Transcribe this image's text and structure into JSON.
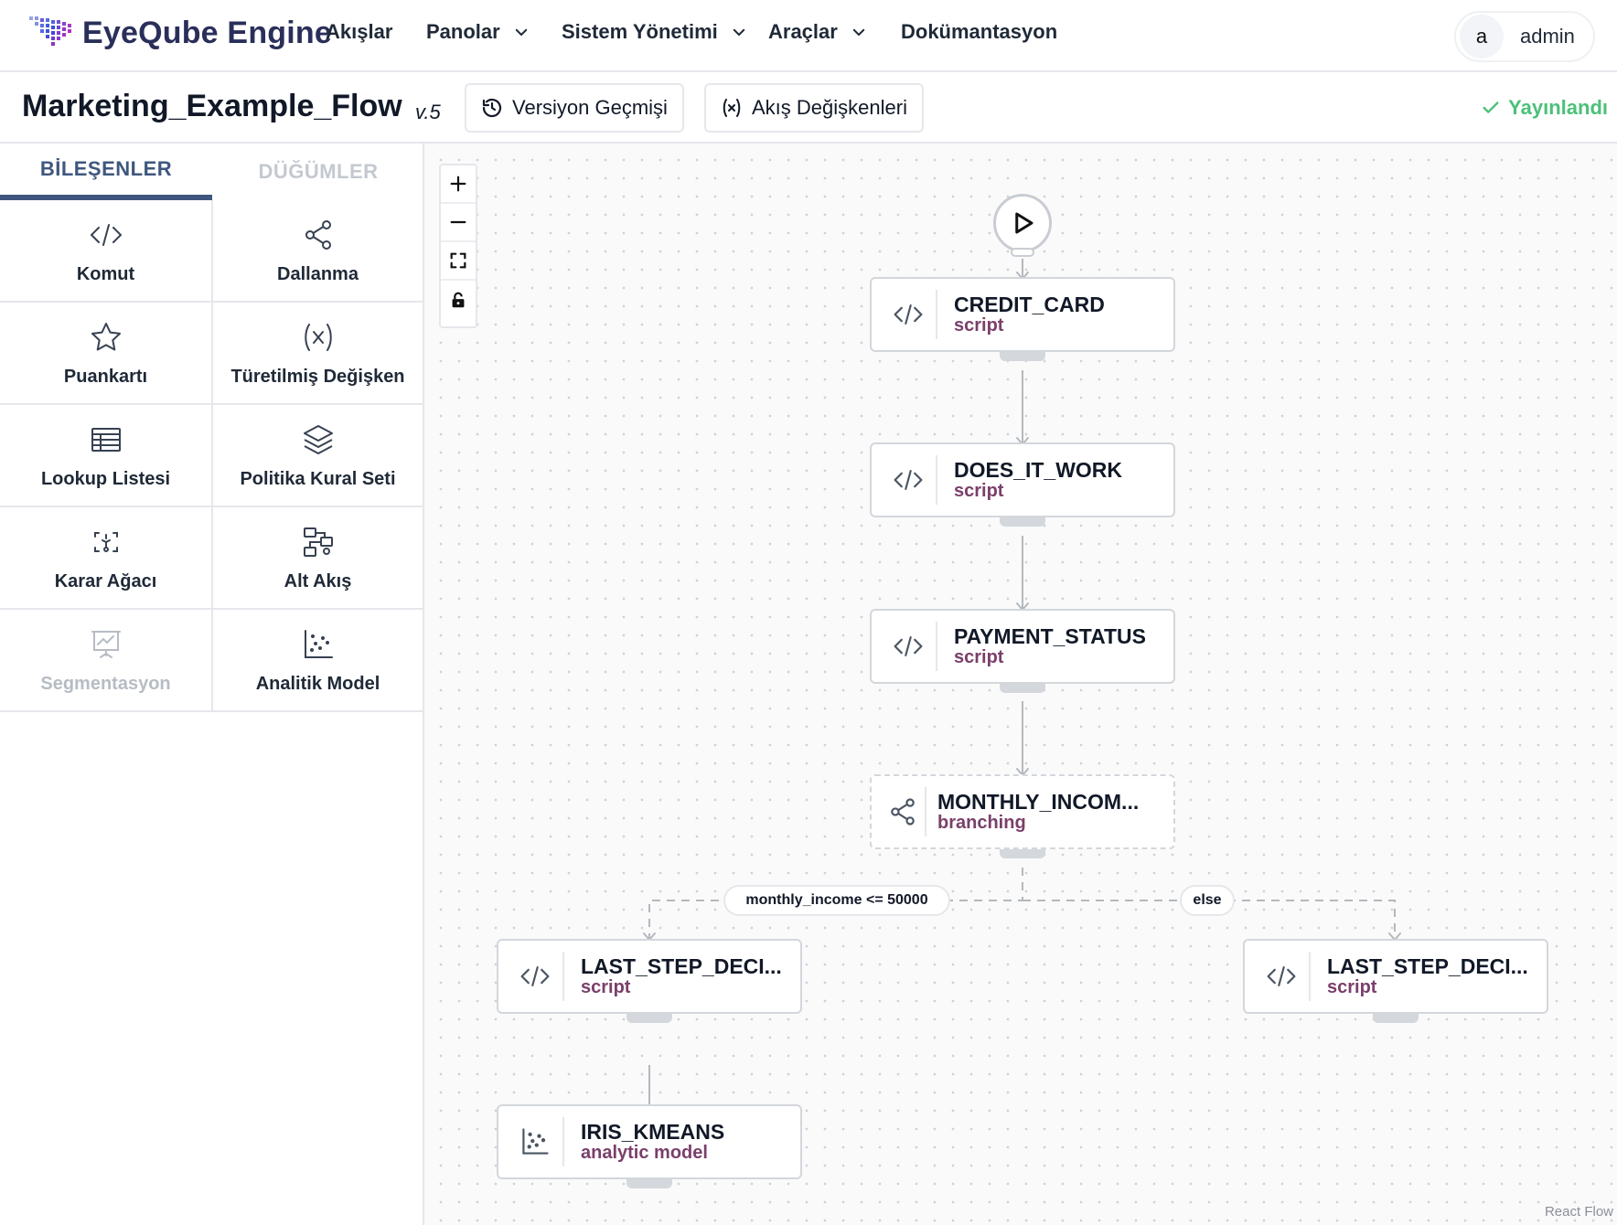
{
  "navbar": {
    "brand": "EyeQube Engine",
    "items": [
      {
        "label": "Akışlar",
        "dropdown": false
      },
      {
        "label": "Panolar",
        "dropdown": true
      },
      {
        "label": "Sistem Yönetimi",
        "dropdown": true
      },
      {
        "label": "Araçlar",
        "dropdown": true
      },
      {
        "label": "Dokümantasyon",
        "dropdown": false
      }
    ],
    "user": {
      "initial": "a",
      "name": "admin"
    }
  },
  "titlebar": {
    "flow_name": "Marketing_Example_Flow",
    "version": "v.5",
    "version_history_label": "Versiyon Geçmişi",
    "flow_variables_label": "Akış Değişkenleri",
    "status": "Yayınlandı",
    "status_color": "#4cc07a"
  },
  "sidebar": {
    "tabs": [
      {
        "label": "BİLEŞENLER",
        "active": true
      },
      {
        "label": "DÜĞÜMLER",
        "active": false
      }
    ],
    "components": [
      {
        "label": "Komut",
        "icon": "code-icon",
        "enabled": true
      },
      {
        "label": "Dallanma",
        "icon": "share-icon",
        "enabled": true
      },
      {
        "label": "Puankartı",
        "icon": "star-icon",
        "enabled": true
      },
      {
        "label": "Türetilmiş Değişken",
        "icon": "variable-icon",
        "enabled": true
      },
      {
        "label": "Lookup Listesi",
        "icon": "table-icon",
        "enabled": true
      },
      {
        "label": "Politika Kural Seti",
        "icon": "layers-icon",
        "enabled": true
      },
      {
        "label": "Karar Ağacı",
        "icon": "decision-tree-icon",
        "enabled": true
      },
      {
        "label": "Alt Akış",
        "icon": "subflow-icon",
        "enabled": true
      },
      {
        "label": "Segmentasyon",
        "icon": "presentation-icon",
        "enabled": false
      },
      {
        "label": "Analitik Model",
        "icon": "scatter-icon",
        "enabled": true
      }
    ]
  },
  "canvas": {
    "controls": [
      "zoom-in",
      "zoom-out",
      "fit-view",
      "lock"
    ],
    "nodes": [
      {
        "name": "CREDIT_CARD",
        "type": "script",
        "icon": "code-icon"
      },
      {
        "name": "DOES_IT_WORK",
        "type": "script",
        "icon": "code-icon"
      },
      {
        "name": "PAYMENT_STATUS",
        "type": "script",
        "icon": "code-icon"
      },
      {
        "name": "MONTHLY_INCOM...",
        "type": "branching",
        "icon": "share-icon"
      },
      {
        "name": "LAST_STEP_DECI...",
        "type": "script",
        "icon": "code-icon"
      },
      {
        "name": "LAST_STEP_DECI...",
        "type": "script",
        "icon": "code-icon"
      },
      {
        "name": "IRIS_KMEANS",
        "type": "analytic model",
        "icon": "scatter-icon"
      }
    ],
    "edge_labels": [
      "monthly_income <= 50000",
      "else"
    ],
    "attribution": "React Flow"
  },
  "colors": {
    "tab_active": "#3f577e",
    "node_type": "#7a3f6a",
    "brand_text": "#2a2f5a"
  }
}
